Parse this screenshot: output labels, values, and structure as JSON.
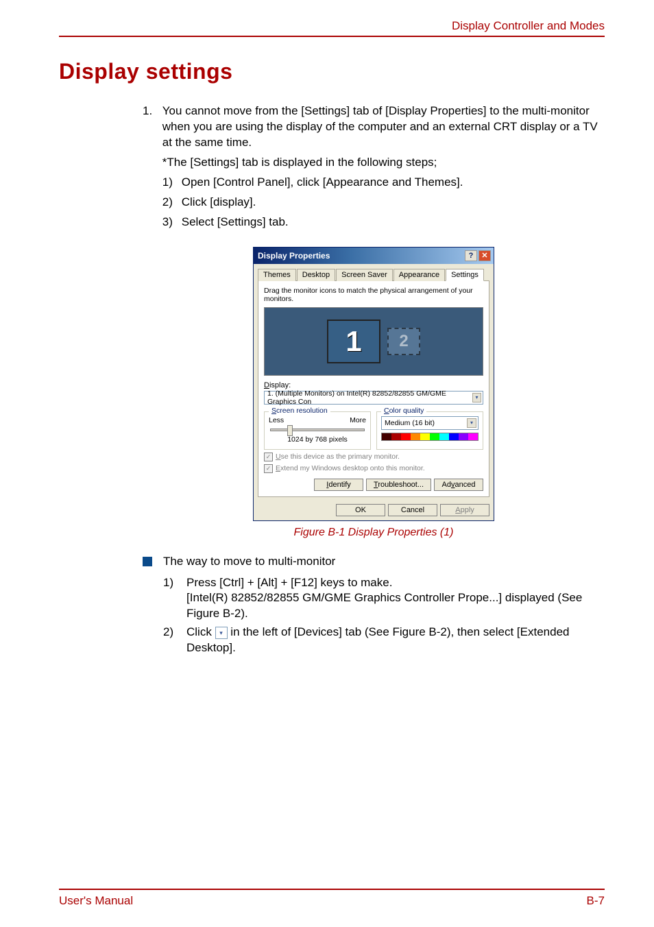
{
  "header": {
    "section": "Display Controller and Modes"
  },
  "title": "Display settings",
  "list1": {
    "num": "1.",
    "p1": "You cannot move from the [Settings] tab of [Display Properties] to the multi-monitor when you are using the display of the computer and an external CRT display or a TV at the same time.",
    "p2": "*The [Settings] tab is displayed in the following steps;",
    "steps": {
      "s1n": "1)",
      "s1": "Open [Control Panel], click [Appearance and Themes].",
      "s2n": "2)",
      "s2": "Click [display].",
      "s3n": "3)",
      "s3": "Select [Settings] tab."
    }
  },
  "dialog": {
    "title": "Display Properties",
    "tabs": {
      "themes": "Themes",
      "desktop": "Desktop",
      "ss": "Screen Saver",
      "app": "Appearance",
      "settings": "Settings"
    },
    "instr": "Drag the monitor icons to match the physical arrangement of your monitors.",
    "mon1": "1",
    "mon2": "2",
    "display_lbl_pre": "D",
    "display_lbl_rest": "isplay:",
    "display_val": "1. (Multiple Monitors) on Intel(R) 82852/82855 GM/GME Graphics Con",
    "res_legend_pre": "S",
    "res_legend_rest": "creen resolution",
    "less": "Less",
    "more": "More",
    "res_val": "1024 by 768 pixels",
    "cq_legend_pre": "C",
    "cq_legend_rest": "olor quality",
    "cq_val": "Medium (16 bit)",
    "chk1_pre": "U",
    "chk1_rest": "se this device as the primary monitor.",
    "chk2_pre": "E",
    "chk2_rest": "xtend my Windows desktop onto this monitor.",
    "identify_pre": "I",
    "identify_rest": "dentify",
    "trouble_pre": "T",
    "trouble_rest": "roubleshoot...",
    "adv_pre": "Ad",
    "adv_u": "v",
    "adv_rest": "anced",
    "ok": "OK",
    "cancel": "Cancel",
    "apply_pre": "A",
    "apply_rest": "pply"
  },
  "caption": "Figure B-1 Display Properties (1)",
  "bullet": {
    "heading": "The way to move to multi-monitor",
    "s1n": "1)",
    "s1a": "Press [Ctrl] + [Alt] + [F12] keys to make.",
    "s1b": "[Intel(R) 82852/82855 GM/GME Graphics Controller Prope...] displayed (See Figure B-2).",
    "s2n": "2)",
    "s2a_pre": "Click ",
    "s2a_post": " in the left of [Devices] tab (See Figure B-2), then select [Extended Desktop]."
  },
  "footer": {
    "left": "User's Manual",
    "right": "B-7"
  }
}
